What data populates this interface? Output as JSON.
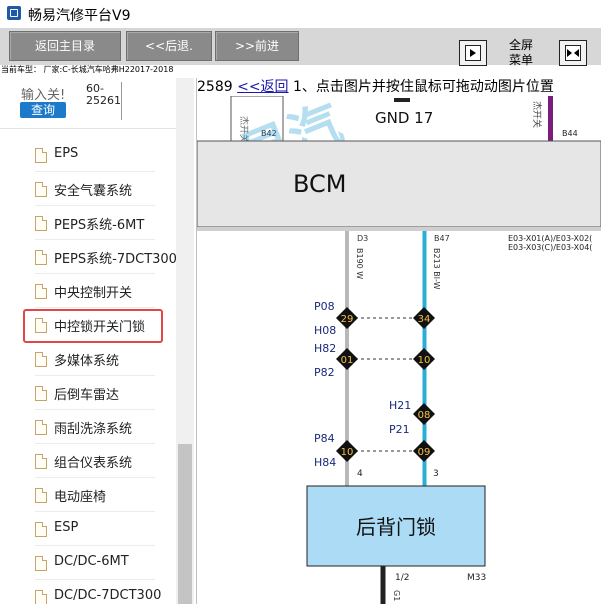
{
  "window": {
    "title": "畅易汽修平台V9"
  },
  "toolbar": {
    "home_label": "返回主目录",
    "back_label": "<<后退.",
    "forward_label": ">>前进",
    "fullscreen_line1": "全屏",
    "fullscreen_line2": "菜单"
  },
  "model_text": "当前车型： 厂家:C-长城汽车哈弗H22017-2018",
  "search": {
    "label": "输入关!",
    "code_line1": "60-",
    "code_line2": "25261",
    "query_label": "查询"
  },
  "sidebar": {
    "items": [
      {
        "label": "EPS"
      },
      {
        "label": "安全气囊系统"
      },
      {
        "label": "PEPS系统-6MT"
      },
      {
        "label": "PEPS系统-7DCT300"
      },
      {
        "label": "中央控制开关"
      },
      {
        "label": "中控锁开关门锁"
      },
      {
        "label": "多媒体系统"
      },
      {
        "label": "后倒车雷达"
      },
      {
        "label": "雨刮洗涤系统"
      },
      {
        "label": "组合仪表系统"
      },
      {
        "label": "电动座椅"
      },
      {
        "label": "ESP"
      },
      {
        "label": "DC/DC-6MT"
      },
      {
        "label": "DC/DC-7DCT300"
      }
    ],
    "selected_index": 5
  },
  "content": {
    "page_number": "2589",
    "back_link": "<<返回",
    "instruction": "1、点击图片并按住鼠标可拖动动图片位置"
  },
  "diagram": {
    "watermark": "畅易汽",
    "top_left_fuse": "杰开关",
    "top_left_pin": "B42",
    "ground_label": "GND 17",
    "top_right_fuse": "杰开关",
    "top_right_pin": "B44",
    "module_label": "BCM",
    "left_pin": "D3",
    "left_wire": "B190 W",
    "right_pin": "B47",
    "right_wire": "B213 Bl-W",
    "connector_line1": "E03-X01(A)/E03-X02(",
    "connector_line2": "E03-X03(C)/E03-X04(",
    "conn_p08": "P08",
    "conn_h08": "H08",
    "conn_h82": "H82",
    "conn_p82": "P82",
    "conn_h21": "H21",
    "conn_p21": "P21",
    "conn_p84": "P84",
    "conn_h84": "H84",
    "node_29": "29",
    "node_34": "34",
    "node_01": "01",
    "node_10a": "10",
    "node_08": "08",
    "node_10b": "10",
    "node_09": "09",
    "pin_4": "4",
    "pin_3": "3",
    "lock_label": "后背门锁",
    "bottom_pin": "1/2",
    "bottom_code": "M33",
    "bottom_wire": "G1"
  }
}
